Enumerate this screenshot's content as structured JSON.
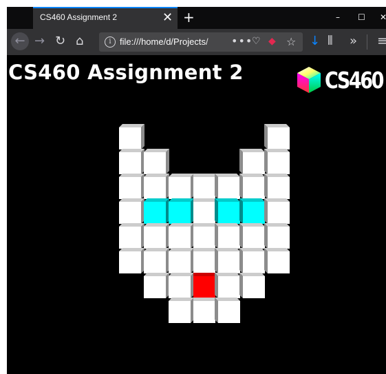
{
  "browser": {
    "tab_title": "CS460 Assignment 2",
    "tab_close": "✕",
    "new_tab": "+",
    "win_min": "–",
    "win_max": "☐",
    "win_close": "✕",
    "back_icon": "←",
    "forward_icon": "→",
    "reload_icon": "↻",
    "home_icon": "⌂",
    "info_icon": "i",
    "url": "file:///home/d/Projects/",
    "page_actions": "•••",
    "pocket_icon": "♡",
    "tracking_icon": "◆",
    "bookmark_icon": "☆",
    "download_icon": "↓",
    "library_icon": "⫴",
    "overflow_icon": "»",
    "menu_icon": "≡"
  },
  "page": {
    "title": "CS460 Assignment 2",
    "logo_text": "CS460"
  },
  "cube_grid": {
    "colors": {
      "white": "#ffffff",
      "cyan": "#00ffff",
      "red": "#ff0000"
    },
    "rows": [
      [
        1,
        0,
        0,
        0,
        0,
        0,
        1
      ],
      [
        1,
        1,
        0,
        0,
        0,
        1,
        1
      ],
      [
        1,
        1,
        1,
        1,
        1,
        1,
        1
      ],
      [
        1,
        2,
        2,
        1,
        2,
        2,
        1
      ],
      [
        1,
        1,
        1,
        1,
        1,
        1,
        1
      ],
      [
        1,
        1,
        1,
        1,
        1,
        1,
        1
      ],
      [
        0,
        1,
        1,
        3,
        1,
        1,
        0
      ],
      [
        0,
        0,
        1,
        1,
        1,
        0,
        0
      ]
    ]
  }
}
